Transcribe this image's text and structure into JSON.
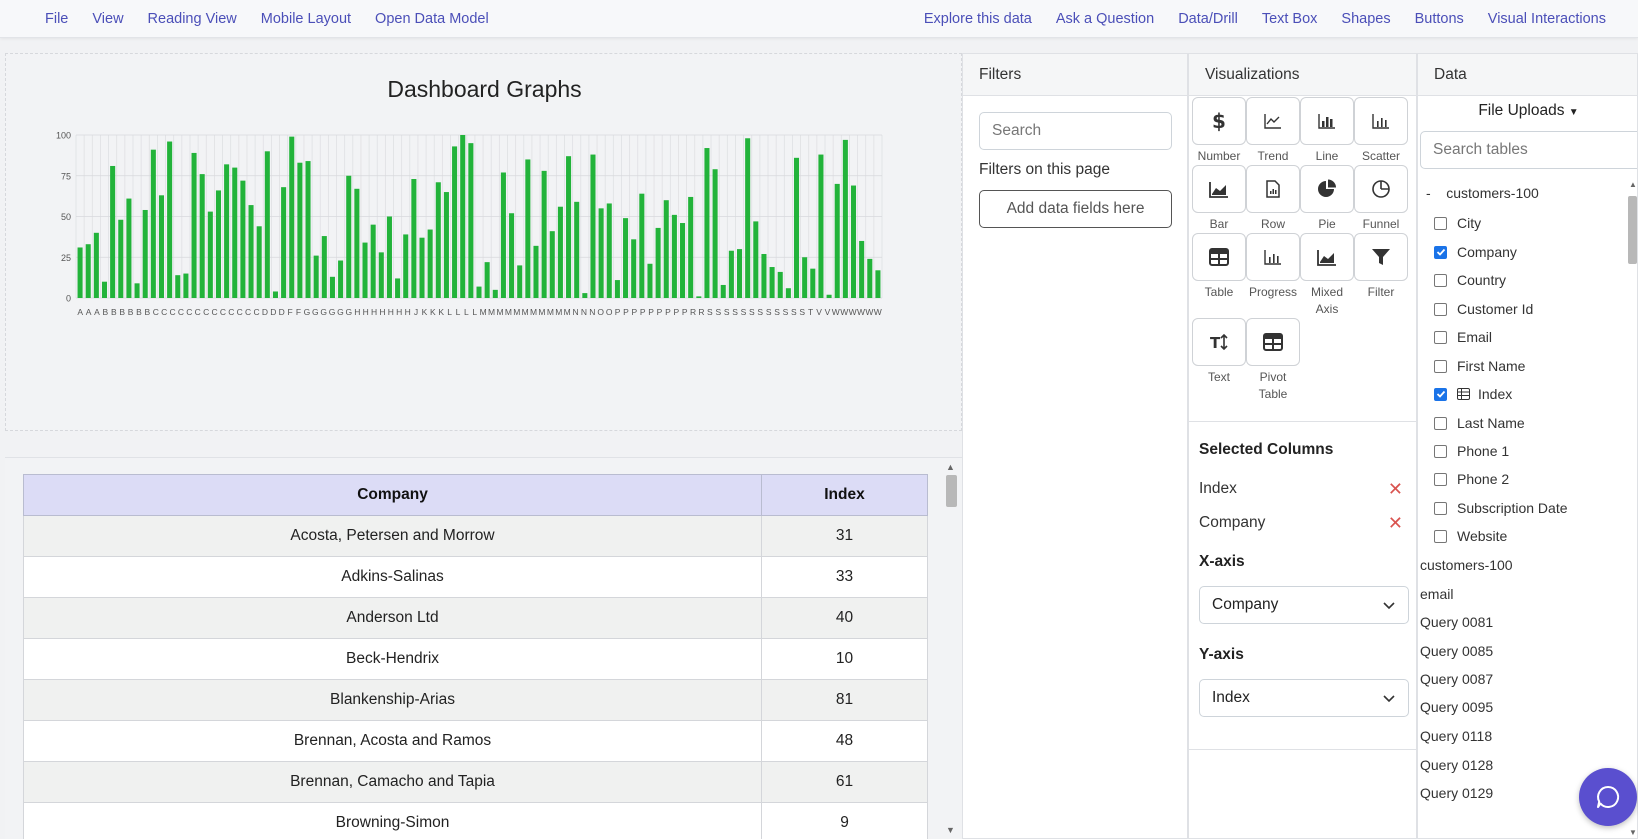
{
  "topbar": {
    "left": [
      "File",
      "View",
      "Reading View",
      "Mobile Layout",
      "Open Data Model"
    ],
    "right": [
      "Explore this data",
      "Ask a Question",
      "Data/Drill",
      "Text Box",
      "Shapes",
      "Buttons",
      "Visual Interactions"
    ]
  },
  "chart_data": {
    "type": "bar",
    "title": "Dashboard Graphs",
    "xlabel": "",
    "ylabel": "",
    "ylim": [
      0,
      100
    ],
    "yticks": [
      0,
      25,
      50,
      75,
      100
    ],
    "grid": true,
    "bar_color": "#22b33a",
    "x_tick_labels": [
      "A",
      "A",
      "A",
      "B",
      "B",
      "B",
      "B",
      "B",
      "B",
      "C",
      "C",
      "C",
      "C",
      "C",
      "C",
      "C",
      "C",
      "C",
      "C",
      "C",
      "C",
      "C",
      "D",
      "D",
      "D",
      "F",
      "F",
      "G",
      "G",
      "G",
      "G",
      "G",
      "G",
      "H",
      "H",
      "H",
      "H",
      "H",
      "H",
      "H",
      "J",
      "K",
      "K",
      "K",
      "L",
      "L",
      "L",
      "L",
      "M",
      "M",
      "M",
      "M",
      "M",
      "M",
      "M",
      "M",
      "M",
      "M",
      "M",
      "N",
      "N",
      "N",
      "O",
      "O",
      "P",
      "P",
      "P",
      "P",
      "P",
      "P",
      "P",
      "P",
      "P",
      "R",
      "R",
      "S",
      "S",
      "S",
      "S",
      "S",
      "S",
      "S",
      "S",
      "S",
      "S",
      "S",
      "S",
      "T",
      "V",
      "V",
      "W",
      "W",
      "W",
      "W",
      "W",
      "W"
    ],
    "values": [
      31,
      33,
      40,
      10,
      81,
      48,
      61,
      9,
      54,
      91,
      63,
      96,
      14,
      15,
      89,
      76,
      53,
      66,
      82,
      80,
      72,
      57,
      44,
      90,
      4,
      68,
      99,
      83,
      84,
      26,
      38,
      13,
      23,
      75,
      67,
      34,
      45,
      28,
      50,
      12,
      39,
      73,
      37,
      42,
      71,
      65,
      93,
      100,
      95,
      7,
      22,
      5,
      77,
      52,
      20,
      85,
      32,
      78,
      41,
      56,
      87,
      59,
      3,
      88,
      55,
      58,
      11,
      49,
      36,
      64,
      21,
      43,
      60,
      51,
      46,
      62,
      1,
      92,
      79,
      8,
      29,
      30,
      98,
      47,
      27,
      19,
      16,
      6,
      86,
      25,
      18,
      88,
      2,
      70,
      97,
      69,
      35,
      24,
      17
    ]
  },
  "table": {
    "headers": [
      "Company",
      "Index"
    ],
    "rows": [
      [
        "Acosta, Petersen and Morrow",
        "31"
      ],
      [
        "Adkins-Salinas",
        "33"
      ],
      [
        "Anderson Ltd",
        "40"
      ],
      [
        "Beck-Hendrix",
        "10"
      ],
      [
        "Blankenship-Arias",
        "81"
      ],
      [
        "Brennan, Acosta and Ramos",
        "48"
      ],
      [
        "Brennan, Camacho and Tapia",
        "61"
      ],
      [
        "Browning-Simon",
        "9"
      ]
    ]
  },
  "filters": {
    "title": "Filters",
    "search_placeholder": "Search",
    "page_label": "Filters on this page",
    "add_label": "Add data fields here"
  },
  "visualizations": {
    "title": "Visualizations",
    "items": [
      {
        "label": "Number",
        "icon": "dollar-icon"
      },
      {
        "label": "Trend",
        "icon": "trend-icon"
      },
      {
        "label": "Line",
        "icon": "line-chart-icon"
      },
      {
        "label": "Scatter",
        "icon": "scatter-icon"
      },
      {
        "label": "Bar",
        "icon": "area-chart-icon"
      },
      {
        "label": "Row",
        "icon": "report-icon"
      },
      {
        "label": "Pie",
        "icon": "pie-chart-icon"
      },
      {
        "label": "Funnel",
        "icon": "funnel-chart-icon"
      },
      {
        "label": "Table",
        "icon": "table-icon"
      },
      {
        "label": "Progress",
        "icon": "progress-icon"
      },
      {
        "label": "Mixed Axis",
        "icon": "mixed-axis-icon"
      },
      {
        "label": "Filter",
        "icon": "filter-icon"
      },
      {
        "label": "Text",
        "icon": "text-icon"
      },
      {
        "label": "Pivot Table",
        "icon": "pivot-table-icon"
      }
    ],
    "selected_title": "Selected Columns",
    "selected": [
      "Index",
      "Company"
    ],
    "x_axis_title": "X-axis",
    "x_axis_value": "Company",
    "y_axis_title": "Y-axis",
    "y_axis_value": "Index"
  },
  "data": {
    "title": "Data",
    "uploads_label": "File Uploads",
    "search_placeholder": "Search tables",
    "root_toggle": "-",
    "root": "customers-100",
    "fields": [
      {
        "name": "City",
        "checked": false
      },
      {
        "name": "Company",
        "checked": true
      },
      {
        "name": "Country",
        "checked": false
      },
      {
        "name": "Customer Id",
        "checked": false
      },
      {
        "name": "Email",
        "checked": false
      },
      {
        "name": "First Name",
        "checked": false
      },
      {
        "name": "Index",
        "checked": true
      },
      {
        "name": "Last Name",
        "checked": false
      },
      {
        "name": "Phone 1",
        "checked": false
      },
      {
        "name": "Phone 2",
        "checked": false
      },
      {
        "name": "Subscription Date",
        "checked": false
      },
      {
        "name": "Website",
        "checked": false
      }
    ],
    "queries": [
      "customers-100",
      "email",
      "Query 0081",
      "Query 0085",
      "Query 0087",
      "Query 0095",
      "Query 0118",
      "Query 0128",
      "Query 0129"
    ]
  },
  "colors": {
    "menu_link": "#4b4fb8",
    "header_bg": "#dcdcf6",
    "bar": "#22b33a",
    "chat_button": "#5a4fcf",
    "remove_x": "#d9534f"
  }
}
